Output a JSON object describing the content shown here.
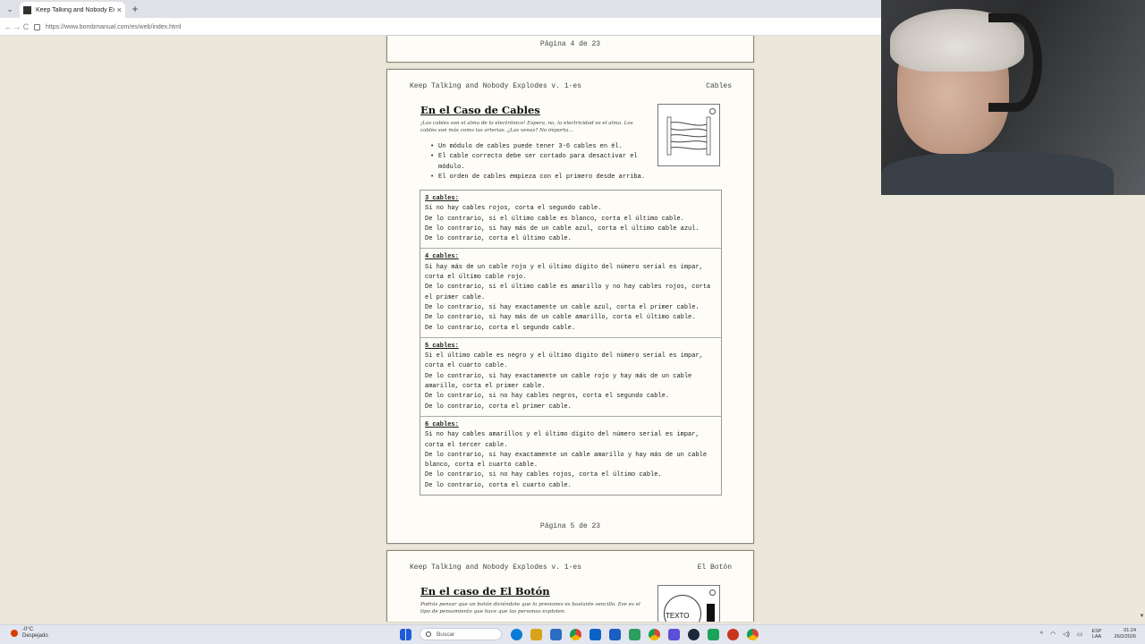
{
  "browser": {
    "tab_title": "Keep Talking and Nobody Explode",
    "tab_close": "×",
    "new_tab": "+",
    "tab_menu": "⌄",
    "back": "←",
    "forward": "→",
    "reload": "C",
    "url": "https://www.bombmanual.com/es/web/index.html"
  },
  "prev_page": {
    "page_number": "Página 4 de 23"
  },
  "main_page": {
    "header_left": "Keep Talking and Nobody Explodes v. 1-es",
    "header_right": "Cables",
    "title": "En el Caso de Cables",
    "flavor": "¡Los cables son el alma de lo electrónico! Espera, no, la electricidad es el alma. Los cables son más como las arterias. ¿Las venas? No importa...",
    "bullets": [
      "Un módulo de cables puede tener 3-6 cables en él.",
      "El cable correcto debe ser cortado para desactivar el módulo.",
      "El orden de cables empieza con el primero desde arriba."
    ],
    "rules": [
      {
        "heading": "3 cables:",
        "lines": [
          "Si no hay cables rojos, corta el segundo cable.",
          "De lo contrario, si el último cable es blanco, corta el último cable.",
          "De lo contrario, si hay más de un cable azul, corta el último cable azul.",
          "De lo contrario, corta el último cable."
        ]
      },
      {
        "heading": "4 cables:",
        "lines": [
          "Si hay más de un cable rojo y el último dígito del número serial es impar, corta el último cable rojo.",
          "De lo contrario, si el último cable es amarillo y no hay cables rojos, corta el primer cable.",
          "De lo contrario, si hay exactamente un cable azul, corta el primer cable.",
          "De lo contrario, si hay más de un cable amarillo, corta el último cable.",
          "De lo contrario, corta el segundo cable."
        ]
      },
      {
        "heading": "5 cables:",
        "lines": [
          "Si el último cable es negro y el último dígito del número serial es impar, corta el cuarto cable.",
          "De lo contrario, si hay exactamente un cable rojo y hay más de un cable amarillo, corta el primer cable.",
          "De lo contrario, si no hay cables negros, corta el segundo cable.",
          "De lo contrario, corta el primer cable."
        ]
      },
      {
        "heading": "6 cables:",
        "lines": [
          "Si no hay cables amarillos y el último dígito del número serial es impar, corta el tercer cable.",
          "De lo contrario, si hay exactamente un cable amarillo y hay más de un cable blanco, corta el cuarto cable.",
          "De lo contrario, si no hay cables rojos, corta el último cable.",
          "De lo contrario, corta el cuarto cable."
        ]
      }
    ],
    "page_number": "Página 5 de 23"
  },
  "next_page": {
    "header_left": "Keep Talking and Nobody Explodes v. 1-es",
    "header_right": "El Botón",
    "title": "En el caso de El Botón",
    "flavor": "Podrás pensar que un botón diciéndote que lo presiones es bastante sencillo. Ese es el tipo de pensamiento que hace que las personas exploten.",
    "button_label": "TEXTO"
  },
  "taskbar": {
    "weather_temp": "-0°C",
    "weather_desc": "Despejado",
    "search_placeholder": "Buscar",
    "lang_top": "ESP",
    "lang_bottom": "LAA",
    "time": "01:24",
    "date": "26/2/2026",
    "tray_chevron": "^",
    "tray_wifi": "◠",
    "tray_volume": "◁)",
    "tray_battery": "▭"
  },
  "colors": {
    "background": "#ebe7da",
    "paper": "#fdfcf7",
    "weather_badge": "#d83b01"
  },
  "taskbar_icon_colors": [
    "#1e5bd6",
    "#0a7ad6",
    "#d9a21b",
    "#2b6cc4",
    "#2d9e5d",
    "#0b63c5",
    "#d44c27",
    "#5b4fd6",
    "#1b1b1b",
    "#1aa35a",
    "#c8341d",
    "#1a73e8"
  ]
}
